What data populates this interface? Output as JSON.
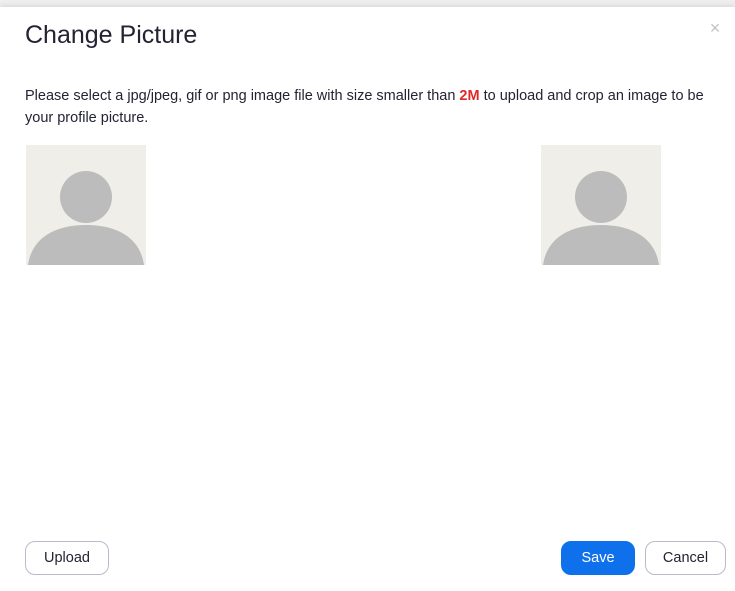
{
  "dialog": {
    "title": "Change Picture",
    "close_symbol": "×",
    "instructions_before": "Please select a jpg/jpeg, gif or png image file with size smaller than ",
    "size_limit": "2M",
    "instructions_after": " to upload and crop an image to be your profile picture."
  },
  "avatars": {
    "source_icon": "default-avatar-icon",
    "preview_icon": "default-avatar-icon"
  },
  "buttons": {
    "upload_label": "Upload",
    "save_label": "Save",
    "cancel_label": "Cancel"
  },
  "colors": {
    "primary": "#0e71eb",
    "highlight": "#e02828",
    "avatar_bg": "#efeee9",
    "avatar_fg": "#bcbcbc"
  }
}
